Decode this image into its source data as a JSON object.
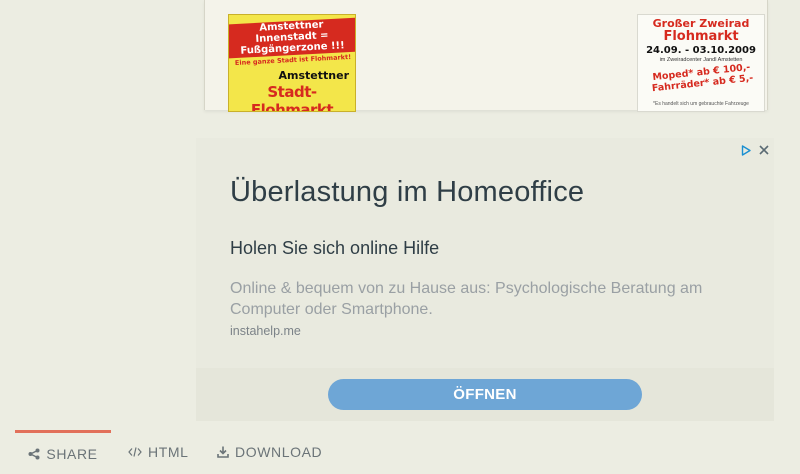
{
  "document": {
    "poster_left": {
      "line1": "Amstettner Innenstadt = Fußgängerzone !!!",
      "line2": "Eine ganze Stadt ist Flohmarkt!",
      "line3": "Amstettner",
      "line4": "Stadt-Flohmarkt"
    },
    "poster_right": {
      "line1": "Großer Zweirad",
      "line2": "Flohmarkt",
      "line3": "24.09. - 03.10.2009",
      "line4": "im Zweiradcenter Jandl Amstetten",
      "line5": "Moped* ab € 100,- Fahrräder* ab € 5,-",
      "line6": "*Es handelt sich um gebrauchte Fahrzeuge"
    }
  },
  "ad": {
    "headline": "Überlastung im Homeoffice",
    "subheadline": "Holen Sie sich online Hilfe",
    "body": "Online & bequem von zu Hause aus: Psychologische Beratung am Computer oder Smartphone.",
    "domain": "instahelp.me",
    "cta_label": "ÖFFNEN",
    "adchoices_icon": "adchoices-play-icon",
    "close_icon": "close-icon",
    "cta_color": "#6ea6d6"
  },
  "share_bar": {
    "tabs": [
      {
        "label": "SHARE",
        "icon": "share-icon",
        "active": true
      },
      {
        "label": "HTML",
        "icon": "code-icon",
        "active": false
      },
      {
        "label": "DOWNLOAD",
        "icon": "download-icon",
        "active": false
      }
    ],
    "accent_color": "#e2705a"
  }
}
